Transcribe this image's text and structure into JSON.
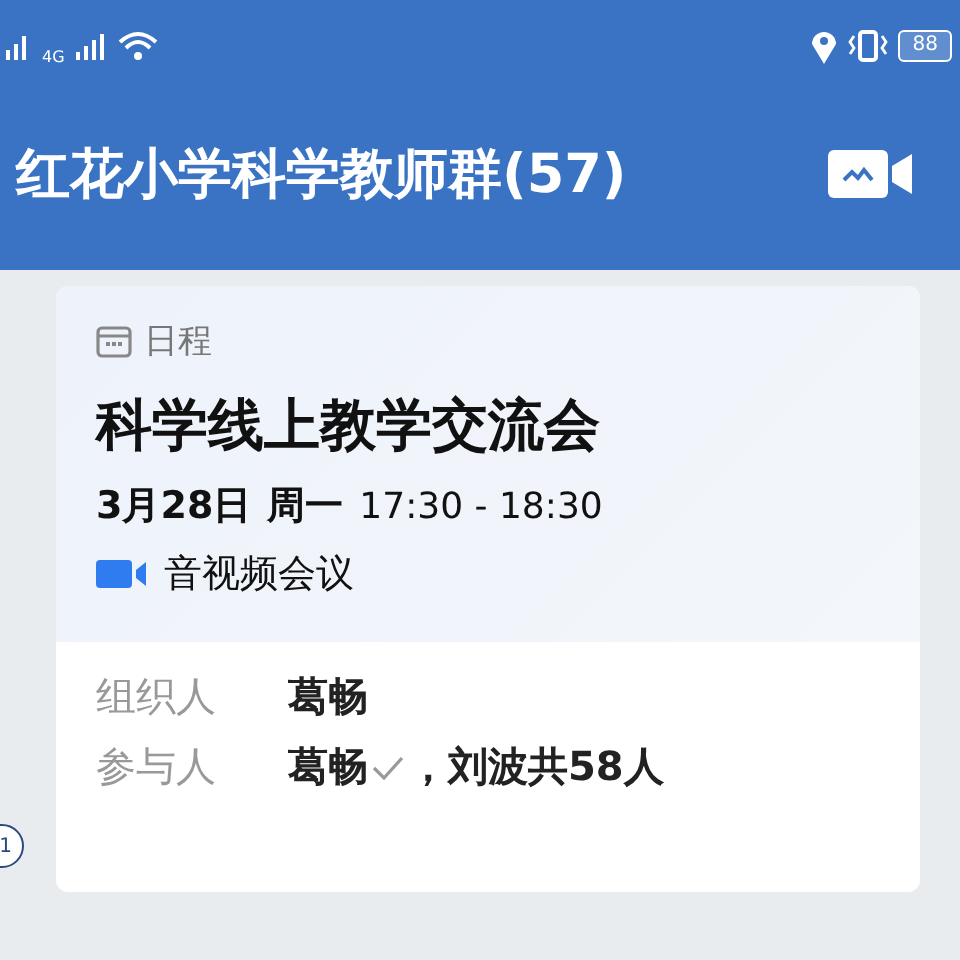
{
  "status_bar": {
    "network": "4G",
    "battery": "88"
  },
  "header": {
    "title": "红花小学科学教师群(57)"
  },
  "card": {
    "tag": "日程",
    "title": "科学线上教学交流会",
    "date": "3月28日",
    "weekday": "周一",
    "time": "17:30 - 18:30",
    "meeting": "音视频会议",
    "organizer": {
      "label": "组织人",
      "value": "葛畅"
    },
    "participants": {
      "label": "参与人",
      "first": "葛畅",
      "first_confirmed": true,
      "rest": "，刘波共58人"
    }
  },
  "side_badge": "1"
}
